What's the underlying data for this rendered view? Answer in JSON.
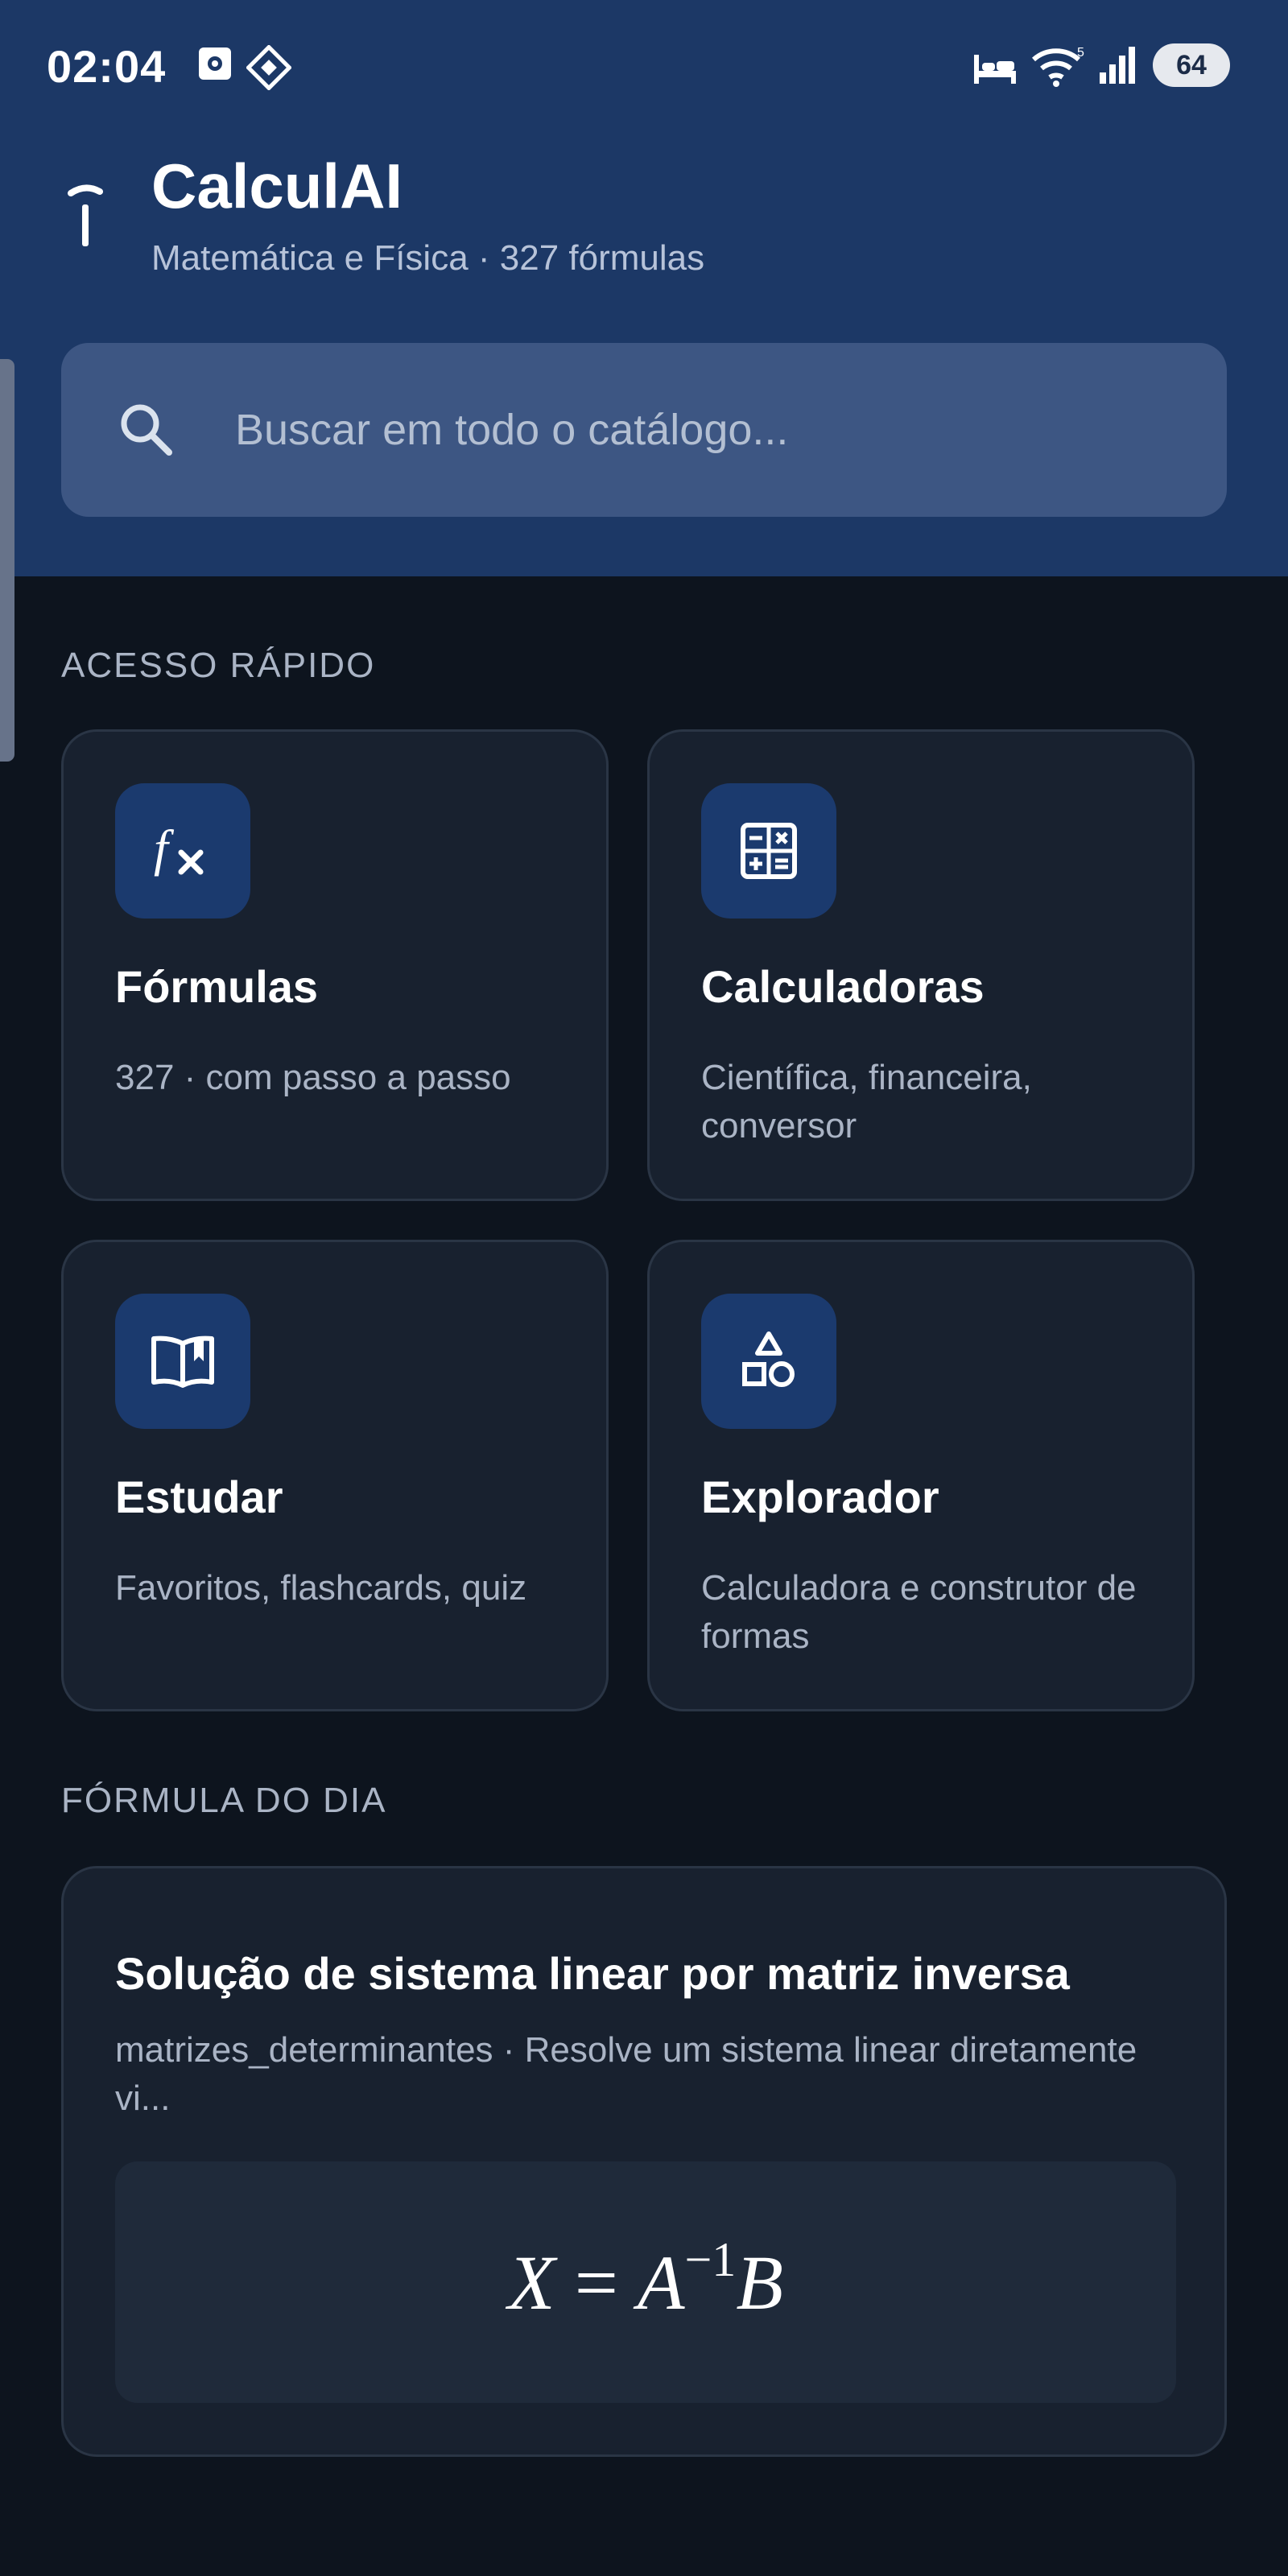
{
  "status_bar": {
    "time": "02:04",
    "battery": "64",
    "icons": [
      "photo-icon",
      "game-icon",
      "bed-icon",
      "wifi-icon",
      "signal-icon"
    ]
  },
  "app": {
    "title": "CalculAI",
    "subtitle": "Matemática e Física · 327 fórmulas"
  },
  "search": {
    "placeholder": "Buscar em todo o catálogo..."
  },
  "quick_access": {
    "label": "ACESSO RÁPIDO",
    "cards": [
      {
        "title": "Fórmulas",
        "description": "327 · com passo a passo",
        "icon": "function-icon"
      },
      {
        "title": "Calculadoras",
        "description": "Científica, financeira, conversor",
        "icon": "calculator-icon"
      },
      {
        "title": "Estudar",
        "description": "Favoritos, flashcards, quiz",
        "icon": "book-icon"
      },
      {
        "title": "Explorador",
        "description": "Calculadora e construtor de formas",
        "icon": "shapes-icon"
      }
    ]
  },
  "formula_of_day": {
    "label": "FÓRMULA DO DIA",
    "title": "Solução de sistema linear por matriz inversa",
    "description": "matrizes_determinantes · Resolve um sistema linear diretamente vi...",
    "formula": {
      "lhs": "X",
      "eq": "=",
      "a": "A",
      "exp": "−1",
      "b": "B"
    }
  },
  "colors": {
    "header_bg": "#1c3866",
    "page_bg": "#0d141e",
    "card_bg": "#18212f",
    "icon_tile_bg": "#1b3a6e"
  }
}
